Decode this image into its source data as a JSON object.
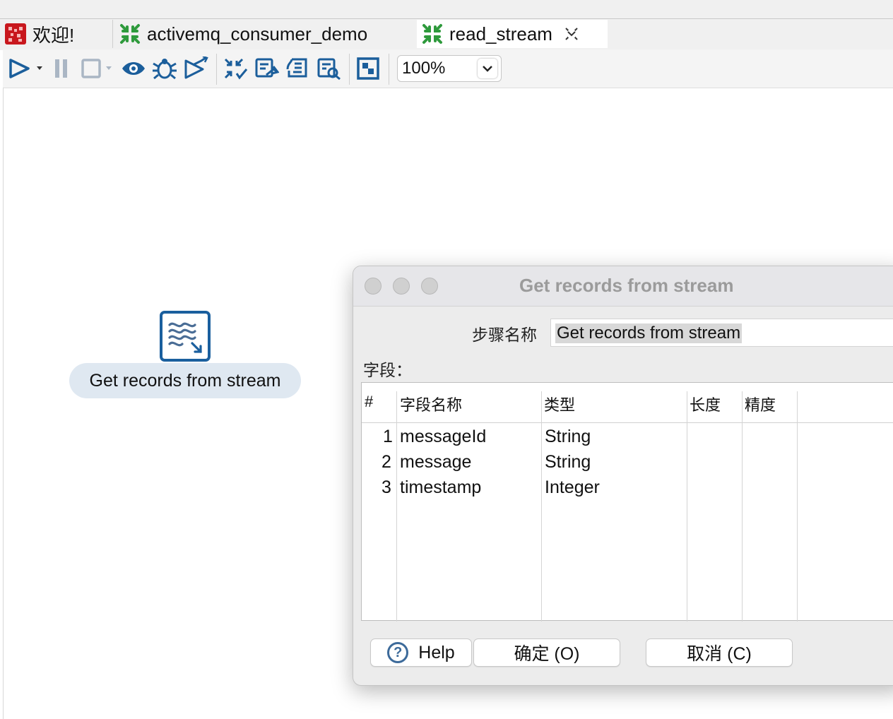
{
  "tabs": [
    {
      "label": "欢迎!",
      "icon": "pentaho-welcome-icon"
    },
    {
      "label": "activemq_consumer_demo",
      "icon": "transformation-icon"
    },
    {
      "label": "read_stream",
      "icon": "transformation-icon",
      "close_icon": "close-icon"
    }
  ],
  "toolbar": {
    "zoom_value": "100%"
  },
  "canvas": {
    "step_label": "Get records from stream"
  },
  "dialog": {
    "title": "Get records from stream",
    "step_name_label": "步骤名称",
    "step_name_value": "Get records from stream",
    "fields_label": "字段：",
    "columns": [
      "#",
      "字段名称",
      "类型",
      "长度",
      "精度"
    ],
    "rows": [
      {
        "num": "1",
        "name": "messageId",
        "type": "String",
        "length": "",
        "precision": ""
      },
      {
        "num": "2",
        "name": "message",
        "type": "String",
        "length": "",
        "precision": ""
      },
      {
        "num": "3",
        "name": "timestamp",
        "type": "Integer",
        "length": "",
        "precision": ""
      }
    ],
    "help_label": "Help",
    "ok_label": "确定 (O)",
    "cancel_label": "取消 (C)"
  },
  "colors": {
    "accent": "#1a5f9e",
    "tab_icon_green": "#2e9a3c",
    "welcome_red": "#c8171d"
  }
}
